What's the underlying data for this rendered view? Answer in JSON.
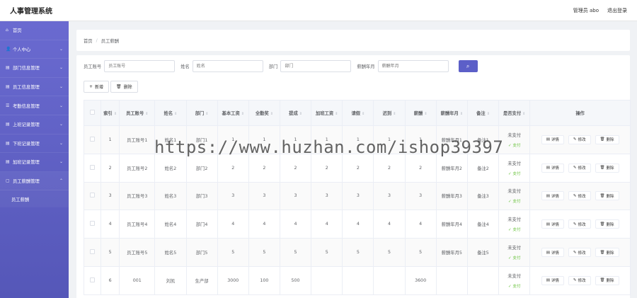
{
  "header": {
    "title": "人事管理系统",
    "admin": "管理员 abo",
    "logout": "退出登录"
  },
  "sidebar": {
    "items": [
      {
        "icon": "⌂",
        "label": "首页",
        "chev": ""
      },
      {
        "icon": "👤",
        "label": "个人中心",
        "chev": "⌄"
      },
      {
        "icon": "▤",
        "label": "部门信息管理",
        "chev": "⌄"
      },
      {
        "icon": "▤",
        "label": "员工信息管理",
        "chev": "⌄"
      },
      {
        "icon": "☰",
        "label": "考勤信息管理",
        "chev": "⌄"
      },
      {
        "icon": "▤",
        "label": "上班记录管理",
        "chev": "⌄"
      },
      {
        "icon": "▤",
        "label": "下班记录管理",
        "chev": "⌄"
      },
      {
        "icon": "▤",
        "label": "加班记录管理",
        "chev": "⌄"
      },
      {
        "icon": "▢",
        "label": "员工薪酬管理",
        "chev": "⌃"
      }
    ],
    "submenu": [
      "员工薪酬"
    ]
  },
  "breadcrumb": {
    "home": "首页",
    "sep": "/",
    "current": "员工薪酬"
  },
  "search": {
    "fields": [
      {
        "label": "员工账号",
        "placeholder": "员工账号"
      },
      {
        "label": "姓名",
        "placeholder": "姓名"
      },
      {
        "label": "部门",
        "placeholder": "部门"
      },
      {
        "label": "薪酬年月",
        "placeholder": "薪酬年月"
      }
    ],
    "button_icon": "⌕"
  },
  "toolbar": {
    "add": "新增",
    "add_icon": "+",
    "delete": "删除",
    "delete_icon": "🗑"
  },
  "table": {
    "headers": [
      "索引",
      "员工账号",
      "姓名",
      "部门",
      "基本工资",
      "全勤奖",
      "提成",
      "加班工资",
      "请假",
      "迟到",
      "薪酬",
      "薪酬年月",
      "备注",
      "是否支付",
      "操作"
    ],
    "rows": [
      [
        "1",
        "员工账号1",
        "姓名1",
        "部门1",
        "1",
        "1",
        "1",
        "1",
        "1",
        "1",
        "1",
        "薪酬年月1",
        "备注1",
        "未支付"
      ],
      [
        "2",
        "员工账号2",
        "姓名2",
        "部门2",
        "2",
        "2",
        "2",
        "2",
        "2",
        "2",
        "2",
        "薪酬年月2",
        "备注2",
        "未支付"
      ],
      [
        "3",
        "员工账号3",
        "姓名3",
        "部门3",
        "3",
        "3",
        "3",
        "3",
        "3",
        "3",
        "3",
        "薪酬年月3",
        "备注3",
        "未支付"
      ],
      [
        "4",
        "员工账号4",
        "姓名4",
        "部门4",
        "4",
        "4",
        "4",
        "4",
        "4",
        "4",
        "4",
        "薪酬年月4",
        "备注4",
        "未支付"
      ],
      [
        "5",
        "员工账号5",
        "姓名5",
        "部门5",
        "5",
        "5",
        "5",
        "5",
        "5",
        "5",
        "5",
        "薪酬年月5",
        "备注5",
        "未支付"
      ],
      [
        "6",
        "001",
        "刘凯",
        "生产部",
        "3000",
        "100",
        "500",
        "",
        "",
        "",
        "3600",
        "",
        "",
        "未支付"
      ]
    ],
    "pay_action": "支付",
    "ops": [
      {
        "icon": "▤",
        "label": "详情"
      },
      {
        "icon": "✎",
        "label": "修改"
      },
      {
        "icon": "🗑",
        "label": "删除"
      }
    ]
  },
  "watermark": "https://www.huzhan.com/ishop39397"
}
